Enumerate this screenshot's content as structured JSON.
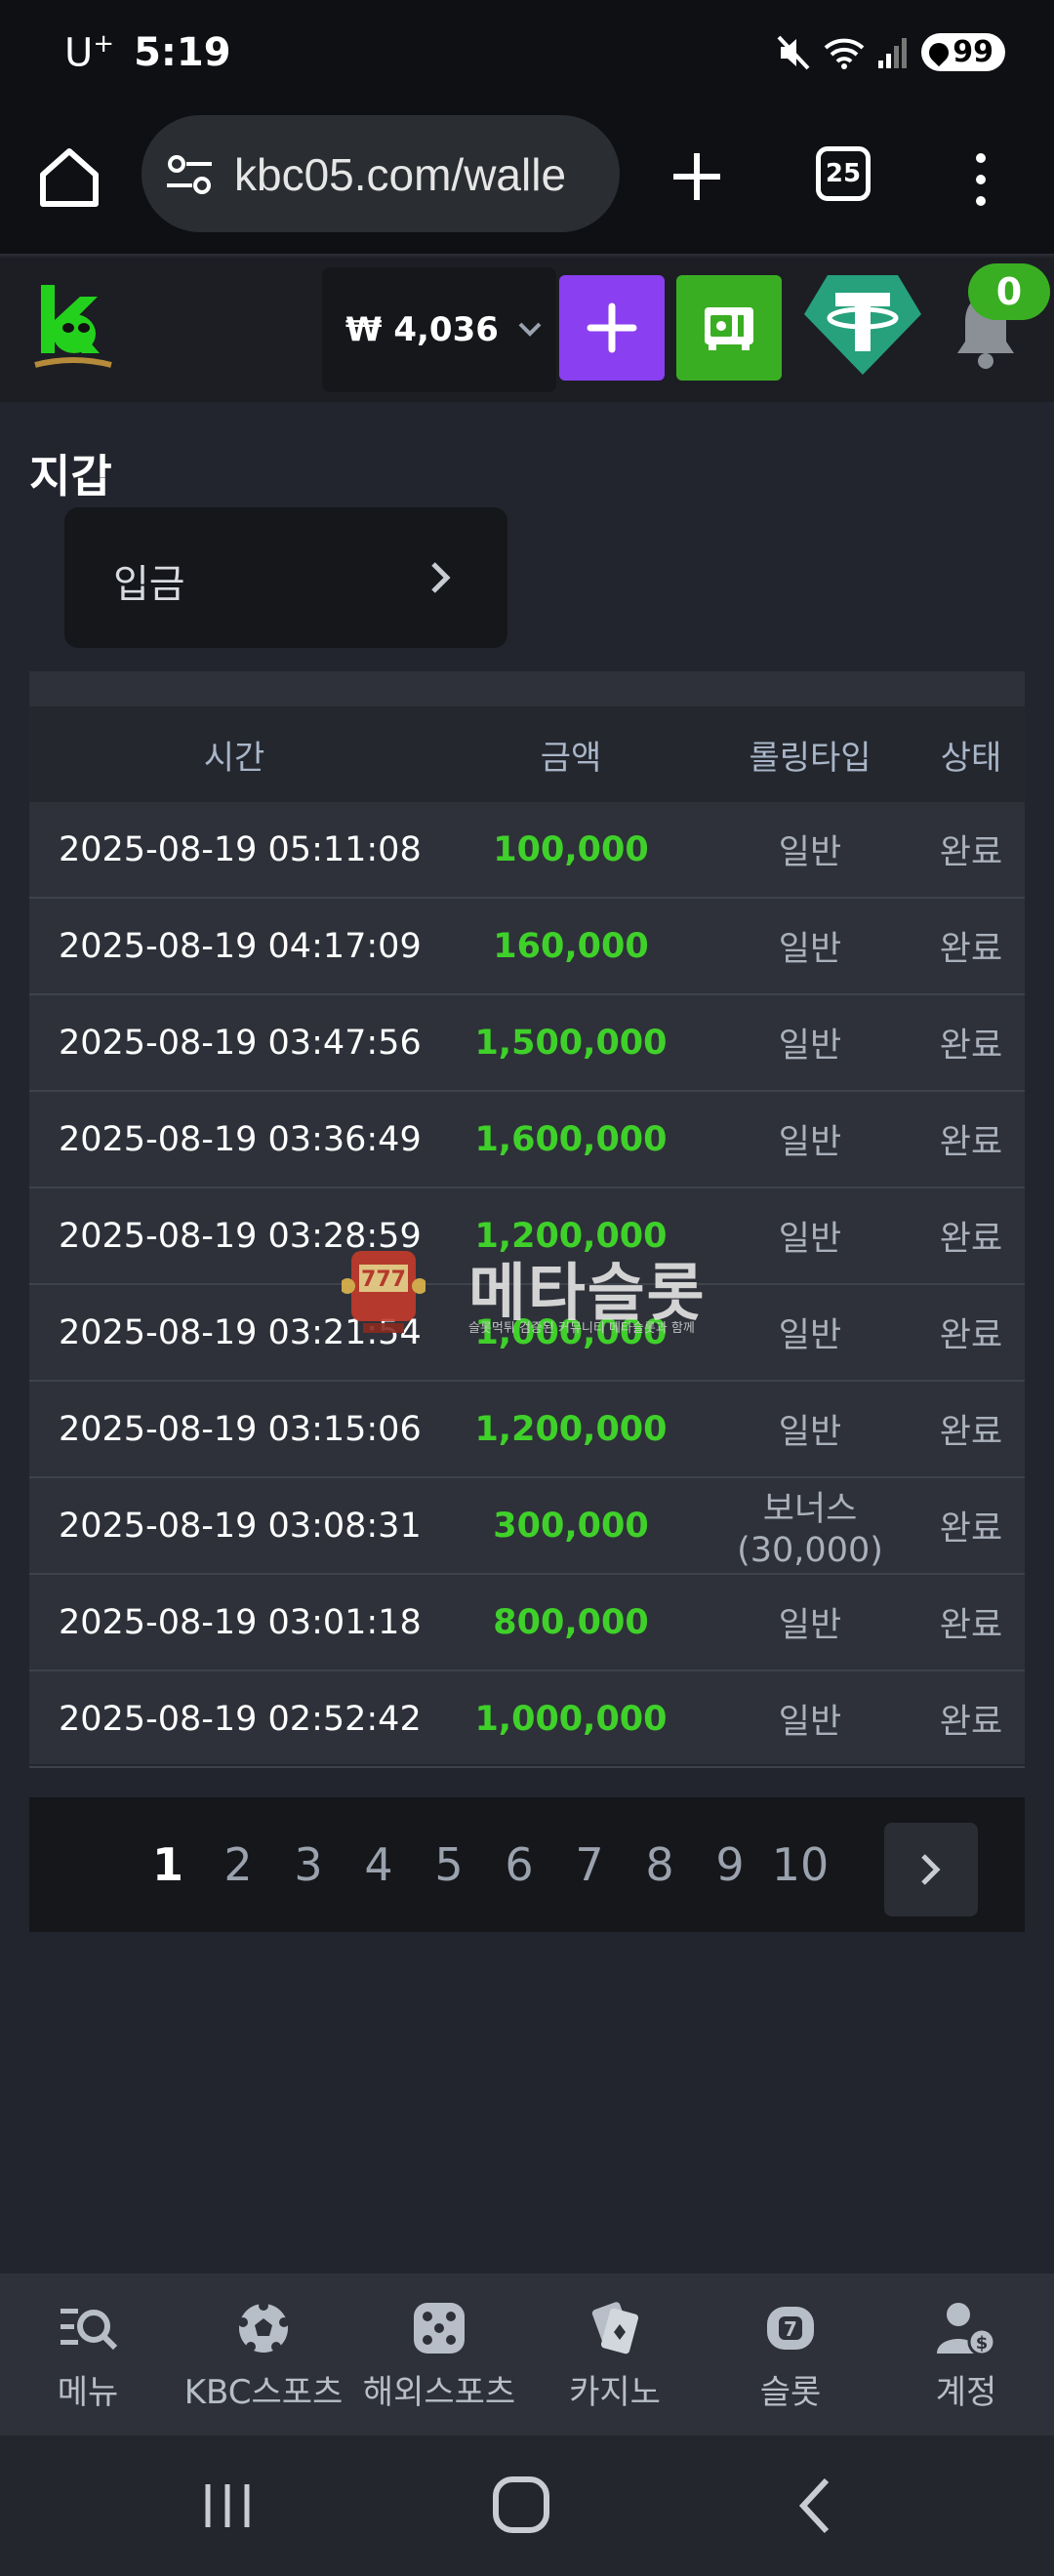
{
  "status_bar": {
    "carrier": "U",
    "carrier_sup": "+",
    "time": "5:19",
    "battery": "99",
    "icons": [
      "mute-icon",
      "wifi-icon",
      "signal-icon",
      "battery-icon"
    ]
  },
  "browser": {
    "url": "kbc05.com/walle",
    "tab_count": "25",
    "icons": [
      "home-icon",
      "site-settings-icon",
      "new-tab-icon",
      "more-icon"
    ]
  },
  "header": {
    "balance": "₩ 4,036",
    "notification_count": "0",
    "colors": {
      "plus": "#8a3ff0",
      "safe": "#3aae22",
      "tether": "#26a17b",
      "badge": "#3aae22"
    }
  },
  "page": {
    "title": "지갑",
    "deposit_label": "입금"
  },
  "table": {
    "columns": [
      "시간",
      "금액",
      "롤링타입",
      "상태"
    ],
    "rows": [
      [
        "2025-08-19 05:11:08",
        "100,000",
        "일반",
        "완료"
      ],
      [
        "2025-08-19 04:17:09",
        "160,000",
        "일반",
        "완료"
      ],
      [
        "2025-08-19 03:47:56",
        "1,500,000",
        "일반",
        "완료"
      ],
      [
        "2025-08-19 03:36:49",
        "1,600,000",
        "일반",
        "완료"
      ],
      [
        "2025-08-19 03:28:59",
        "1,200,000",
        "일반",
        "완료"
      ],
      [
        "2025-08-19 03:21:54",
        "1,000,000",
        "일반",
        "완료"
      ],
      [
        "2025-08-19 03:15:06",
        "1,200,000",
        "일반",
        "완료"
      ],
      [
        "2025-08-19 03:08:31",
        "300,000",
        "보너스 (30,000)",
        "완료"
      ],
      [
        "2025-08-19 03:01:18",
        "800,000",
        "일반",
        "완료"
      ],
      [
        "2025-08-19 02:52:42",
        "1,000,000",
        "일반",
        "완료"
      ]
    ],
    "amount_color": "#3fd12a"
  },
  "pagination": {
    "pages": [
      "1",
      "2",
      "3",
      "4",
      "5",
      "6",
      "7",
      "8",
      "9",
      "10"
    ],
    "current": "1"
  },
  "watermark": {
    "text": "메타슬롯",
    "subtext": "슬롯먹튀 검증된 커뮤니티 메타슬롯과 함께"
  },
  "bottom_nav": [
    {
      "label": "메뉴",
      "icon": "menu-search-icon"
    },
    {
      "label": "KBC스포츠",
      "icon": "soccer-ball-icon"
    },
    {
      "label": "해외스포츠",
      "icon": "dice-icon"
    },
    {
      "label": "카지노",
      "icon": "cards-icon"
    },
    {
      "label": "슬롯",
      "icon": "slot-icon"
    },
    {
      "label": "계정",
      "icon": "account-icon"
    }
  ]
}
